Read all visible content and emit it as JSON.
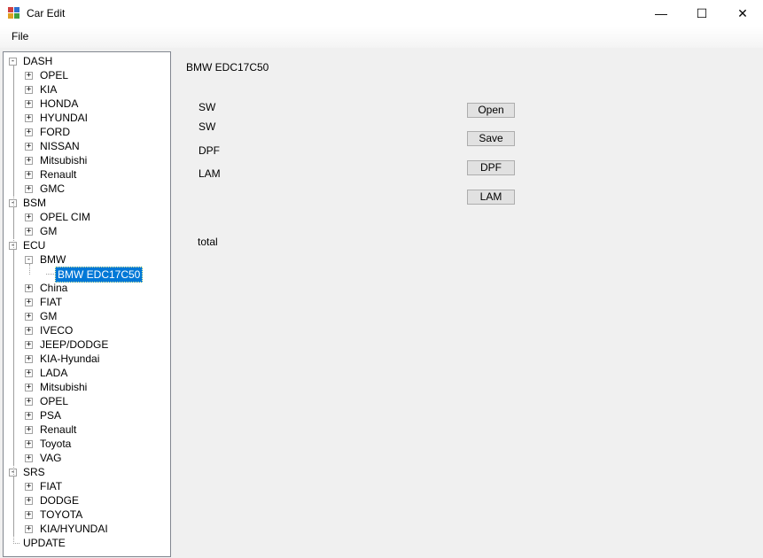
{
  "window": {
    "title": "Car Edit",
    "controls": {
      "minimize": "—",
      "maximize": "☐",
      "close": "✕"
    }
  },
  "menu": {
    "file": "File"
  },
  "tree": {
    "root1": {
      "label": "DASH",
      "children": [
        "OPEL",
        "KIA",
        "HONDA",
        "HYUNDAI",
        "FORD",
        "NISSAN",
        "Mitsubishi",
        "Renault",
        "GMC"
      ]
    },
    "root2": {
      "label": "BSM",
      "children": [
        "OPEL CIM",
        "GM"
      ]
    },
    "root3": {
      "label": "ECU",
      "bmw": "BMW",
      "bmw_child": "BMW EDC17C50",
      "children": [
        "China",
        "FIAT",
        "GM",
        "IVECO",
        "JEEP/DODGE",
        "KIA-Hyundai",
        "LADA",
        "Mitsubishi",
        "OPEL",
        "PSA",
        "Renault",
        "Toyota",
        "VAG"
      ]
    },
    "root4": {
      "label": "SRS",
      "children": [
        "FIAT",
        "DODGE",
        "TOYOTA",
        "KIA/HYUNDAI"
      ]
    },
    "root5": {
      "label": "UPDATE"
    }
  },
  "panel": {
    "heading": "BMW EDC17C50",
    "sw1": "SW",
    "sw2": "SW",
    "dpf": "DPF",
    "lam": "LAM",
    "total": "total",
    "buttons": {
      "open": "Open",
      "save": "Save",
      "dpf": "DPF",
      "lam": "LAM"
    }
  }
}
